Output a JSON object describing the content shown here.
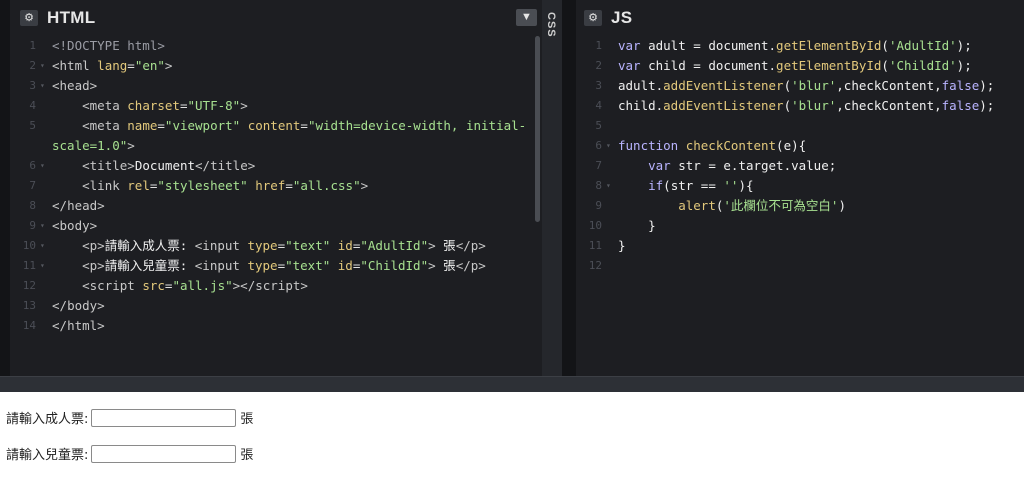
{
  "html_panel": {
    "title": "HTML",
    "gear_icon": "gear-icon",
    "lines": [
      {
        "n": "1",
        "fold": "",
        "segs": [
          [
            "t-doc",
            "<!DOCTYPE html>"
          ]
        ]
      },
      {
        "n": "2",
        "fold": "▾",
        "segs": [
          [
            "t-tag",
            "<"
          ],
          [
            "t-name",
            "html "
          ],
          [
            "t-attr",
            "lang"
          ],
          [
            "t-punc",
            "="
          ],
          [
            "t-str",
            "\"en\""
          ],
          [
            "t-tag",
            ">"
          ]
        ]
      },
      {
        "n": "3",
        "fold": "▾",
        "segs": [
          [
            "t-tag",
            "<"
          ],
          [
            "t-name",
            "head"
          ],
          [
            "t-tag",
            ">"
          ]
        ]
      },
      {
        "n": "4",
        "fold": "",
        "segs": [
          [
            "t-txt",
            "    "
          ],
          [
            "t-tag",
            "<"
          ],
          [
            "t-name",
            "meta "
          ],
          [
            "t-attr",
            "charset"
          ],
          [
            "t-punc",
            "="
          ],
          [
            "t-str",
            "\"UTF-8\""
          ],
          [
            "t-tag",
            ">"
          ]
        ]
      },
      {
        "n": "5",
        "fold": "",
        "segs": [
          [
            "t-txt",
            "    "
          ],
          [
            "t-tag",
            "<"
          ],
          [
            "t-name",
            "meta "
          ],
          [
            "t-attr",
            "name"
          ],
          [
            "t-punc",
            "="
          ],
          [
            "t-str",
            "\"viewport\" "
          ],
          [
            "t-attr",
            "content"
          ],
          [
            "t-punc",
            "="
          ],
          [
            "t-str",
            "\"width=device-width, initial-"
          ]
        ]
      },
      {
        "n": "",
        "fold": "",
        "segs": [
          [
            "t-str",
            "scale=1.0\""
          ],
          [
            "t-tag",
            ">"
          ]
        ]
      },
      {
        "n": "6",
        "fold": "▾",
        "segs": [
          [
            "t-txt",
            "    "
          ],
          [
            "t-tag",
            "<"
          ],
          [
            "t-name",
            "title"
          ],
          [
            "t-tag",
            ">"
          ],
          [
            "t-txt",
            "Document"
          ],
          [
            "t-tag",
            "</"
          ],
          [
            "t-name",
            "title"
          ],
          [
            "t-tag",
            ">"
          ]
        ]
      },
      {
        "n": "7",
        "fold": "",
        "segs": [
          [
            "t-txt",
            "    "
          ],
          [
            "t-tag",
            "<"
          ],
          [
            "t-name",
            "link "
          ],
          [
            "t-attr",
            "rel"
          ],
          [
            "t-punc",
            "="
          ],
          [
            "t-str",
            "\"stylesheet\" "
          ],
          [
            "t-attr",
            "href"
          ],
          [
            "t-punc",
            "="
          ],
          [
            "t-str",
            "\"all.css\""
          ],
          [
            "t-tag",
            ">"
          ]
        ]
      },
      {
        "n": "8",
        "fold": "",
        "segs": [
          [
            "t-tag",
            "</"
          ],
          [
            "t-name",
            "head"
          ],
          [
            "t-tag",
            ">"
          ]
        ]
      },
      {
        "n": "9",
        "fold": "▾",
        "segs": [
          [
            "t-tag",
            "<"
          ],
          [
            "t-name",
            "body"
          ],
          [
            "t-tag",
            ">"
          ]
        ]
      },
      {
        "n": "10",
        "fold": "▾",
        "segs": [
          [
            "t-txt",
            "    "
          ],
          [
            "t-tag",
            "<"
          ],
          [
            "t-name",
            "p"
          ],
          [
            "t-tag",
            ">"
          ],
          [
            "t-txt",
            "請輸入成人票: "
          ],
          [
            "t-tag",
            "<"
          ],
          [
            "t-name",
            "input "
          ],
          [
            "t-attr",
            "type"
          ],
          [
            "t-punc",
            "="
          ],
          [
            "t-str",
            "\"text\" "
          ],
          [
            "t-attr",
            "id"
          ],
          [
            "t-punc",
            "="
          ],
          [
            "t-str",
            "\"AdultId\""
          ],
          [
            "t-tag",
            "> "
          ],
          [
            "t-txt",
            "張"
          ],
          [
            "t-tag",
            "</"
          ],
          [
            "t-name",
            "p"
          ],
          [
            "t-tag",
            ">"
          ]
        ]
      },
      {
        "n": "11",
        "fold": "▾",
        "segs": [
          [
            "t-txt",
            "    "
          ],
          [
            "t-tag",
            "<"
          ],
          [
            "t-name",
            "p"
          ],
          [
            "t-tag",
            ">"
          ],
          [
            "t-txt",
            "請輸入兒童票: "
          ],
          [
            "t-tag",
            "<"
          ],
          [
            "t-name",
            "input "
          ],
          [
            "t-attr",
            "type"
          ],
          [
            "t-punc",
            "="
          ],
          [
            "t-str",
            "\"text\" "
          ],
          [
            "t-attr",
            "id"
          ],
          [
            "t-punc",
            "="
          ],
          [
            "t-str",
            "\"ChildId\""
          ],
          [
            "t-tag",
            "> "
          ],
          [
            "t-txt",
            "張"
          ],
          [
            "t-tag",
            "</"
          ],
          [
            "t-name",
            "p"
          ],
          [
            "t-tag",
            ">"
          ]
        ]
      },
      {
        "n": "12",
        "fold": "",
        "segs": [
          [
            "t-txt",
            "    "
          ],
          [
            "t-tag",
            "<"
          ],
          [
            "t-name",
            "script "
          ],
          [
            "t-attr",
            "src"
          ],
          [
            "t-punc",
            "="
          ],
          [
            "t-str",
            "\"all.js\""
          ],
          [
            "t-tag",
            "></"
          ],
          [
            "t-name",
            "script"
          ],
          [
            "t-tag",
            ">"
          ]
        ]
      },
      {
        "n": "13",
        "fold": "",
        "segs": [
          [
            "t-tag",
            "</"
          ],
          [
            "t-name",
            "body"
          ],
          [
            "t-tag",
            ">"
          ]
        ]
      },
      {
        "n": "14",
        "fold": "",
        "segs": [
          [
            "t-tag",
            "</"
          ],
          [
            "t-name",
            "html"
          ],
          [
            "t-tag",
            ">"
          ]
        ]
      }
    ]
  },
  "css_panel": {
    "label": "CSS"
  },
  "js_panel": {
    "title": "JS",
    "gear_icon": "gear-icon",
    "lines": [
      {
        "n": "1",
        "fold": "",
        "segs": [
          [
            "t-kw",
            "var "
          ],
          [
            "t-txt",
            "adult = document."
          ],
          [
            "t-fn",
            "getElementById"
          ],
          [
            "t-txt",
            "("
          ],
          [
            "t-str",
            "'AdultId'"
          ],
          [
            "t-txt",
            ");"
          ]
        ]
      },
      {
        "n": "2",
        "fold": "",
        "segs": [
          [
            "t-kw",
            "var "
          ],
          [
            "t-txt",
            "child = document."
          ],
          [
            "t-fn",
            "getElementById"
          ],
          [
            "t-txt",
            "("
          ],
          [
            "t-str",
            "'ChildId'"
          ],
          [
            "t-txt",
            ");"
          ]
        ]
      },
      {
        "n": "3",
        "fold": "",
        "segs": [
          [
            "t-txt",
            "adult."
          ],
          [
            "t-fn",
            "addEventListener"
          ],
          [
            "t-txt",
            "("
          ],
          [
            "t-str",
            "'blur'"
          ],
          [
            "t-txt",
            ",checkContent,"
          ],
          [
            "t-kw",
            "false"
          ],
          [
            "t-txt",
            ");"
          ]
        ]
      },
      {
        "n": "4",
        "fold": "",
        "segs": [
          [
            "t-txt",
            "child."
          ],
          [
            "t-fn",
            "addEventListener"
          ],
          [
            "t-txt",
            "("
          ],
          [
            "t-str",
            "'blur'"
          ],
          [
            "t-txt",
            ",checkContent,"
          ],
          [
            "t-kw",
            "false"
          ],
          [
            "t-txt",
            ");"
          ]
        ]
      },
      {
        "n": "5",
        "fold": "",
        "segs": []
      },
      {
        "n": "6",
        "fold": "▾",
        "segs": [
          [
            "t-kw",
            "function "
          ],
          [
            "t-fn",
            "checkContent"
          ],
          [
            "t-txt",
            "(e){"
          ]
        ]
      },
      {
        "n": "7",
        "fold": "",
        "segs": [
          [
            "t-txt",
            "    "
          ],
          [
            "t-kw",
            "var "
          ],
          [
            "t-txt",
            "str = e.target.value;"
          ]
        ]
      },
      {
        "n": "8",
        "fold": "▾",
        "segs": [
          [
            "t-txt",
            "    "
          ],
          [
            "t-kw",
            "if"
          ],
          [
            "t-txt",
            "(str == "
          ],
          [
            "t-str",
            "''"
          ],
          [
            "t-txt",
            "){"
          ]
        ]
      },
      {
        "n": "9",
        "fold": "",
        "segs": [
          [
            "t-txt",
            "        "
          ],
          [
            "t-fn",
            "alert"
          ],
          [
            "t-txt",
            "("
          ],
          [
            "t-str",
            "'此欄位不可為空白'"
          ],
          [
            "t-txt",
            ")"
          ]
        ]
      },
      {
        "n": "10",
        "fold": "",
        "segs": [
          [
            "t-txt",
            "    }"
          ]
        ]
      },
      {
        "n": "11",
        "fold": "",
        "segs": [
          [
            "t-txt",
            "}"
          ]
        ]
      },
      {
        "n": "12",
        "fold": "",
        "segs": []
      }
    ]
  },
  "result": {
    "rows": [
      {
        "label": "請輸入成人票:",
        "value": "",
        "suffix": "張"
      },
      {
        "label": "請輸入兒童票:",
        "value": "",
        "suffix": "張"
      }
    ]
  }
}
